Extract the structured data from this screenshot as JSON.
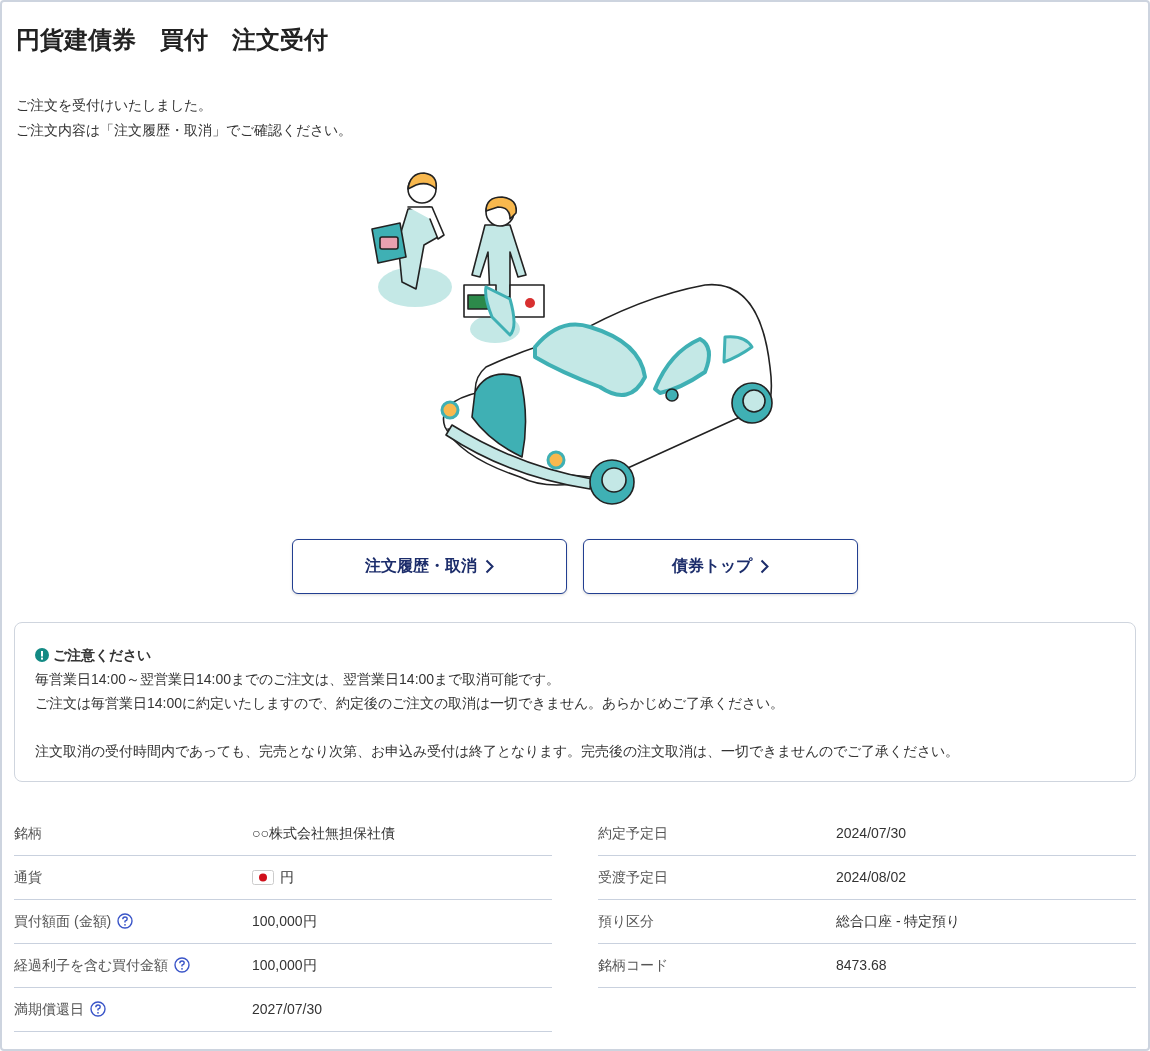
{
  "title": "円貨建債券　買付　注文受付",
  "messages": [
    "ご注文を受付けいたしました。",
    "ご注文内容は「注文履歴・取消」でご確認ください。"
  ],
  "buttons": [
    {
      "label": "注文履歴・取消"
    },
    {
      "label": "債券トップ"
    }
  ],
  "notice": {
    "title": "ご注意ください",
    "paragraphs": [
      [
        "毎営業日14:00～翌営業日14:00までのご注文は、翌営業日14:00まで取消可能です。",
        "ご注文は毎営業日14:00に約定いたしますので、約定後のご注文の取消は一切できません。あらかじめご了承ください。"
      ],
      [
        "注文取消の受付時間内であっても、完売となり次第、お申込み受付は終了となります。完売後の注文取消は、一切できませんのでご了承ください。"
      ]
    ]
  },
  "details": {
    "left": [
      {
        "label": "銘柄",
        "value": "○○株式会社無担保社債",
        "kind": "text",
        "help": false
      },
      {
        "label": "通貨",
        "value": "円",
        "kind": "currency",
        "help": false
      },
      {
        "label": "買付額面 (金額)",
        "value": "100,000円",
        "kind": "text",
        "help": true
      },
      {
        "label": "経過利子を含む買付金額",
        "value": "100,000円",
        "kind": "text",
        "help": true
      },
      {
        "label": "満期償還日",
        "value": "2027/07/30",
        "kind": "text",
        "help": true
      }
    ],
    "right": [
      {
        "label": "約定予定日",
        "value": "2024/07/30",
        "kind": "text",
        "help": false
      },
      {
        "label": "受渡予定日",
        "value": "2024/08/02",
        "kind": "text",
        "help": false
      },
      {
        "label": "預り区分",
        "value": "総合口座 - 特定預り",
        "kind": "text",
        "help": false
      },
      {
        "label": "銘柄コード",
        "value": "8473.68",
        "kind": "text",
        "help": false
      }
    ]
  }
}
